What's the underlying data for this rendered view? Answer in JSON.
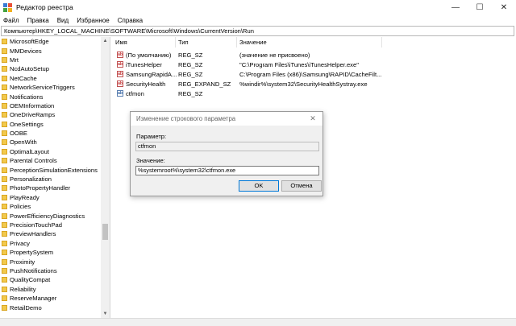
{
  "window": {
    "title": "Редактор реестра",
    "controls": {
      "minimize": "—",
      "maximize": "☐",
      "close": "✕"
    }
  },
  "menu": [
    "Файл",
    "Правка",
    "Вид",
    "Избранное",
    "Справка"
  ],
  "address": "Компьютер\\HKEY_LOCAL_MACHINE\\SOFTWARE\\Microsoft\\Windows\\CurrentVersion\\Run",
  "tree": {
    "items": [
      "MicrosoftEdge",
      "MMDevices",
      "Mrt",
      "NcdAutoSetup",
      "NetCache",
      "NetworkServiceTriggers",
      "Notifications",
      "OEMInformation",
      "OneDriveRamps",
      "OneSettings",
      "OOBE",
      "OpenWith",
      "OptimalLayout",
      "Parental Controls",
      "PerceptionSimulationExtensions",
      "Personalization",
      "PhotoPropertyHandler",
      "PlayReady",
      "Policies",
      "PowerEfficiencyDiagnostics",
      "PrecisionTouchPad",
      "PreviewHandlers",
      "Privacy",
      "PropertySystem",
      "Proximity",
      "PushNotifications",
      "QualityCompat",
      "Reliability",
      "ReserveManager",
      "RetailDemo"
    ],
    "scroll_up": "▲",
    "scroll_down": "▼"
  },
  "values": {
    "columns": {
      "name": "Имя",
      "type": "Тип",
      "data": "Значение"
    },
    "rows": [
      {
        "icon": "ab",
        "name": "(По умолчанию)",
        "type": "REG_SZ",
        "data": "(значение не присвоено)"
      },
      {
        "icon": "ab",
        "name": "iTunesHelper",
        "type": "REG_SZ",
        "data": "\"C:\\Program Files\\iTunes\\iTunesHelper.exe\""
      },
      {
        "icon": "ab",
        "name": "SamsungRapidA...",
        "type": "REG_SZ",
        "data": "C:\\Program Files (x86)\\Samsung\\RAPID\\CacheFilt..."
      },
      {
        "icon": "ab",
        "name": "SecurityHealth",
        "type": "REG_EXPAND_SZ",
        "data": "%windir%\\system32\\SecurityHealthSystray.exe"
      },
      {
        "icon": "ab",
        "name": "ctfmon",
        "type": "REG_SZ",
        "data": ""
      }
    ]
  },
  "dialog": {
    "title": "Изменение строкового параметра",
    "close": "✕",
    "param_label": "Параметр:",
    "param_value": "ctfmon",
    "value_label": "Значение:",
    "value_value": "%systemroot%\\system32\\ctfmon.exe",
    "ok_label": "OK",
    "cancel_label": "Отмена"
  },
  "colors": {
    "folder": "#f2c94c",
    "accent": "#0078d7"
  }
}
